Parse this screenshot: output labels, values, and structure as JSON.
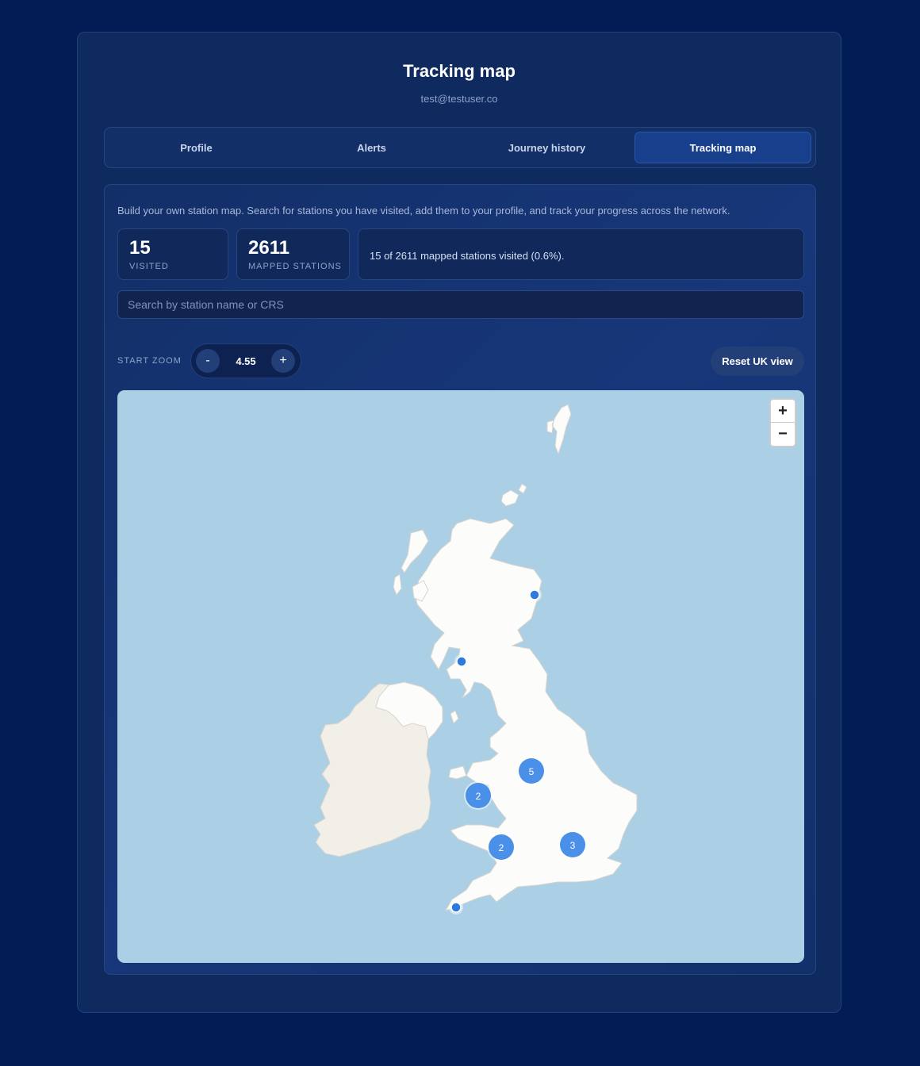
{
  "header": {
    "title": "Tracking map",
    "email": "test@testuser.co"
  },
  "tabs": [
    {
      "label": "Profile",
      "active": false
    },
    {
      "label": "Alerts",
      "active": false
    },
    {
      "label": "Journey history",
      "active": false
    },
    {
      "label": "Tracking map",
      "active": true
    }
  ],
  "intro": "Build your own station map. Search for stations you have visited, add them to your profile, and track your progress across the network.",
  "stats": {
    "visited": {
      "value": "15",
      "label": "VISITED"
    },
    "mapped": {
      "value": "2611",
      "label": "MAPPED STATIONS"
    },
    "summary": "15 of 2611 mapped stations visited (0.6%)."
  },
  "search": {
    "placeholder": "Search by station name or CRS",
    "value": ""
  },
  "zoom": {
    "label": "START ZOOM",
    "minus": "-",
    "value": "4.55",
    "plus": "+"
  },
  "reset_label": "Reset UK view",
  "map": {
    "zoom_in": "+",
    "zoom_out": "−",
    "clusters": [
      {
        "count": "5"
      },
      {
        "count": "2"
      },
      {
        "count": "2"
      },
      {
        "count": "3"
      }
    ],
    "colors": {
      "sea": "#abd0e6",
      "land": "#fcfcfa",
      "ireland": "#f2efe9",
      "marker": "#2a7ae2",
      "cluster": "#4a8fe8"
    }
  }
}
